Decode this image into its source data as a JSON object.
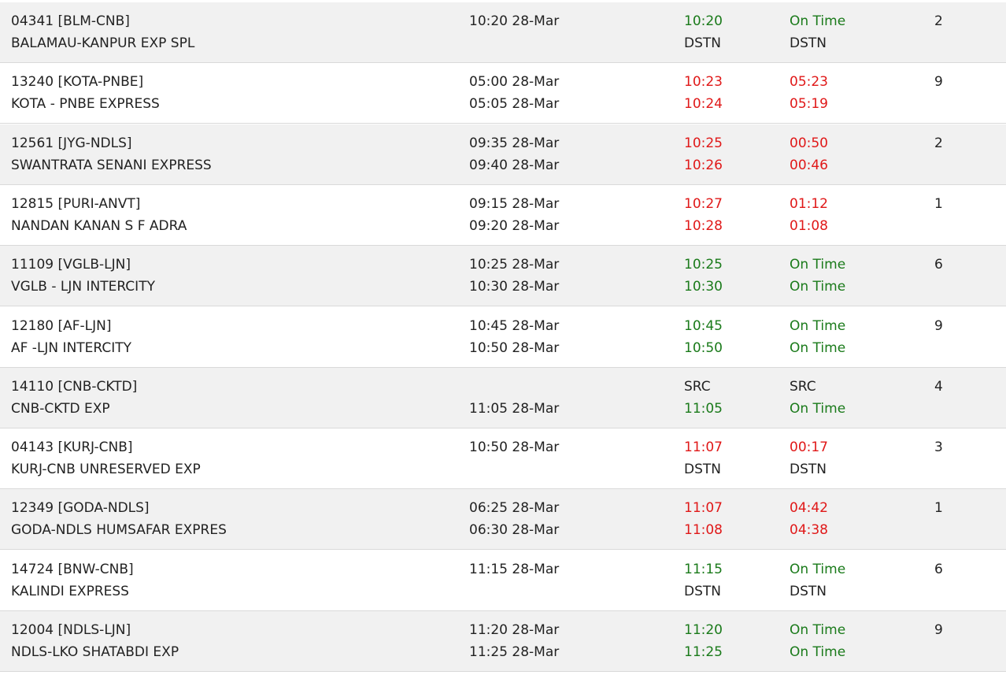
{
  "colors": {
    "on_time": "#1a7a1a",
    "late": "#e01818",
    "text": "#222222",
    "row_shade": "#f1f1f1",
    "row_plain": "#ffffff",
    "divider": "#d9d9d9"
  },
  "trains": [
    {
      "number": "04341 [BLM-CNB]",
      "name": "BALAMAU-KANPUR EXP SPL",
      "sched_arr": "10:20 28-Mar",
      "sched_dep": "",
      "exp_arr": "10:20",
      "exp_arr_status": "ok",
      "exp_dep": "DSTN",
      "exp_dep_status": "neu",
      "delay_arr": "On Time",
      "delay_arr_status": "ok",
      "delay_dep": "DSTN",
      "delay_dep_status": "neu",
      "platform": "2"
    },
    {
      "number": "13240 [KOTA-PNBE]",
      "name": "KOTA - PNBE EXPRESS",
      "sched_arr": "05:00 28-Mar",
      "sched_dep": "05:05 28-Mar",
      "exp_arr": "10:23",
      "exp_arr_status": "late",
      "exp_dep": "10:24",
      "exp_dep_status": "late",
      "delay_arr": "05:23",
      "delay_arr_status": "late",
      "delay_dep": "05:19",
      "delay_dep_status": "late",
      "platform": "9"
    },
    {
      "number": "12561 [JYG-NDLS]",
      "name": "SWANTRATA SENANI EXPRESS",
      "sched_arr": "09:35 28-Mar",
      "sched_dep": "09:40 28-Mar",
      "exp_arr": "10:25",
      "exp_arr_status": "late",
      "exp_dep": "10:26",
      "exp_dep_status": "late",
      "delay_arr": "00:50",
      "delay_arr_status": "late",
      "delay_dep": "00:46",
      "delay_dep_status": "late",
      "platform": "2"
    },
    {
      "number": "12815 [PURI-ANVT]",
      "name": "NANDAN KANAN S F ADRA",
      "sched_arr": "09:15 28-Mar",
      "sched_dep": "09:20 28-Mar",
      "exp_arr": "10:27",
      "exp_arr_status": "late",
      "exp_dep": "10:28",
      "exp_dep_status": "late",
      "delay_arr": "01:12",
      "delay_arr_status": "late",
      "delay_dep": "01:08",
      "delay_dep_status": "late",
      "platform": "1"
    },
    {
      "number": "11109 [VGLB-LJN]",
      "name": "VGLB - LJN INTERCITY",
      "sched_arr": "10:25 28-Mar",
      "sched_dep": "10:30 28-Mar",
      "exp_arr": "10:25",
      "exp_arr_status": "ok",
      "exp_dep": "10:30",
      "exp_dep_status": "ok",
      "delay_arr": "On Time",
      "delay_arr_status": "ok",
      "delay_dep": "On Time",
      "delay_dep_status": "ok",
      "platform": "6"
    },
    {
      "number": "12180 [AF-LJN]",
      "name": "AF -LJN INTERCITY",
      "sched_arr": "10:45 28-Mar",
      "sched_dep": "10:50 28-Mar",
      "exp_arr": "10:45",
      "exp_arr_status": "ok",
      "exp_dep": "10:50",
      "exp_dep_status": "ok",
      "delay_arr": "On Time",
      "delay_arr_status": "ok",
      "delay_dep": "On Time",
      "delay_dep_status": "ok",
      "platform": "9"
    },
    {
      "number": "14110 [CNB-CKTD]",
      "name": "CNB-CKTD EXP",
      "sched_arr": "",
      "sched_dep": "11:05 28-Mar",
      "exp_arr": "SRC",
      "exp_arr_status": "neu",
      "exp_dep": "11:05",
      "exp_dep_status": "ok",
      "delay_arr": "SRC",
      "delay_arr_status": "neu",
      "delay_dep": "On Time",
      "delay_dep_status": "ok",
      "platform": "4"
    },
    {
      "number": "04143 [KURJ-CNB]",
      "name": "KURJ-CNB UNRESERVED EXP",
      "sched_arr": "10:50 28-Mar",
      "sched_dep": "",
      "exp_arr": "11:07",
      "exp_arr_status": "late",
      "exp_dep": "DSTN",
      "exp_dep_status": "neu",
      "delay_arr": "00:17",
      "delay_arr_status": "late",
      "delay_dep": "DSTN",
      "delay_dep_status": "neu",
      "platform": "3"
    },
    {
      "number": "12349 [GODA-NDLS]",
      "name": "GODA-NDLS HUMSAFAR EXPRES",
      "sched_arr": "06:25 28-Mar",
      "sched_dep": "06:30 28-Mar",
      "exp_arr": "11:07",
      "exp_arr_status": "late",
      "exp_dep": "11:08",
      "exp_dep_status": "late",
      "delay_arr": "04:42",
      "delay_arr_status": "late",
      "delay_dep": "04:38",
      "delay_dep_status": "late",
      "platform": "1"
    },
    {
      "number": "14724 [BNW-CNB]",
      "name": "KALINDI EXPRESS",
      "sched_arr": "11:15 28-Mar",
      "sched_dep": "",
      "exp_arr": "11:15",
      "exp_arr_status": "ok",
      "exp_dep": "DSTN",
      "exp_dep_status": "neu",
      "delay_arr": "On Time",
      "delay_arr_status": "ok",
      "delay_dep": "DSTN",
      "delay_dep_status": "neu",
      "platform": "6"
    },
    {
      "number": "12004 [NDLS-LJN]",
      "name": "NDLS-LKO SHATABDI EXP",
      "sched_arr": "11:20 28-Mar",
      "sched_dep": "11:25 28-Mar",
      "exp_arr": "11:20",
      "exp_arr_status": "ok",
      "exp_dep": "11:25",
      "exp_dep_status": "ok",
      "delay_arr": "On Time",
      "delay_arr_status": "ok",
      "delay_dep": "On Time",
      "delay_dep_status": "ok",
      "platform": "9"
    }
  ]
}
